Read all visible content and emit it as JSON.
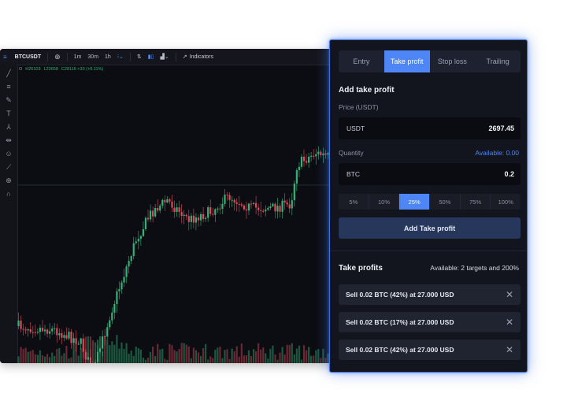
{
  "chart": {
    "symbol": "BTCUSDT",
    "intervals": [
      "1m",
      "30m",
      "1h"
    ],
    "indicators_label": "Indicators",
    "ohlc": {
      "open": "O",
      "high": "H26103",
      "low": "L23658",
      "close": "C28116 +33 (+0.11%)"
    },
    "up_color": "#2fb37a",
    "down_color": "#e0475a"
  },
  "panel": {
    "tabs": [
      {
        "label": "Entry",
        "active": false
      },
      {
        "label": "Take profit",
        "active": true
      },
      {
        "label": "Stop loss",
        "active": false
      },
      {
        "label": "Trailing",
        "active": false
      }
    ],
    "add_heading": "Add take profit",
    "price_label": "Price (USDT)",
    "price_unit": "USDT",
    "price_value": "2697.45",
    "quantity_label": "Quantity",
    "quantity_available": "Available: 0.00",
    "quantity_unit": "BTC",
    "quantity_value": "0.2",
    "percentages": [
      {
        "label": "5%",
        "active": false
      },
      {
        "label": "10%",
        "active": false
      },
      {
        "label": "25%",
        "active": true
      },
      {
        "label": "50%",
        "active": false
      },
      {
        "label": "75%",
        "active": false
      },
      {
        "label": "100%",
        "active": false
      }
    ],
    "add_button": "Add Take profit",
    "list_heading": "Take profits",
    "list_available": "Available: 2 targets and 200%",
    "targets": [
      {
        "text": "Sell 0.02 BTC (42%) at 27.000 USD"
      },
      {
        "text": "Sell 0.02 BTC (17%) at 27.000 USD"
      },
      {
        "text": "Sell 0.02 BTC (42%) at 27.000 USD"
      }
    ],
    "accent_color": "#4f86f7"
  }
}
